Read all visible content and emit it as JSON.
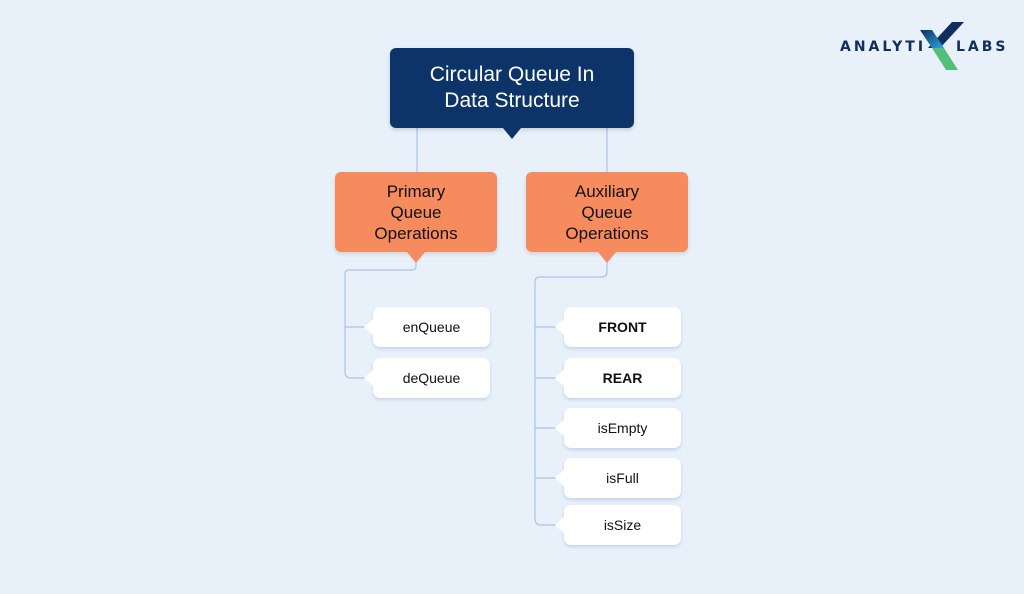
{
  "logo": {
    "left_text": "ANALYTI",
    "right_text": "LABS",
    "icon": "x-logo-icon"
  },
  "title": {
    "line1": "Circular Queue In",
    "line2": "Data Structure"
  },
  "branches": [
    {
      "line1": "Primary",
      "line2": "Queue",
      "line3": "Operations",
      "items": [
        "enQueue",
        "deQueue"
      ]
    },
    {
      "line1": "Auxiliary",
      "line2": "Queue",
      "line3": "Operations",
      "items": [
        "FRONT",
        "REAR",
        "isEmpty",
        "isFull",
        "isSize"
      ]
    }
  ],
  "colors": {
    "title_bg": "#0d3468",
    "branch_bg": "#f68b5e",
    "background": "#e8f0fa",
    "connector": "#a9c3ec"
  }
}
